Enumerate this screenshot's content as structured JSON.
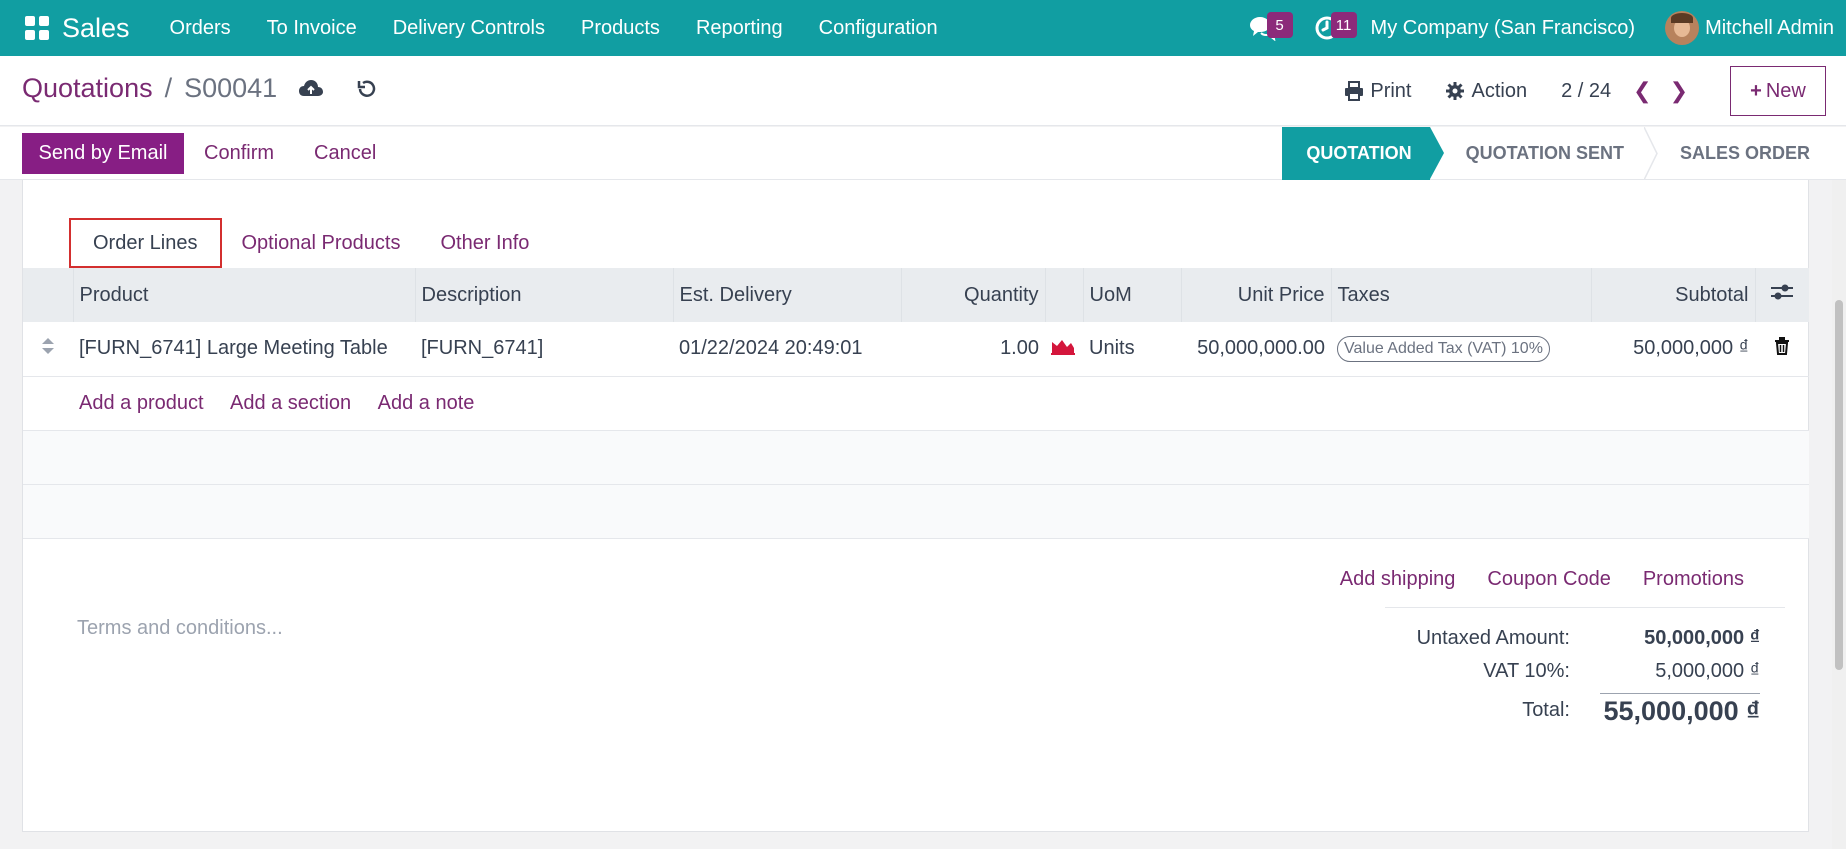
{
  "navbar": {
    "brand": "Sales",
    "menu": [
      "Orders",
      "To Invoice",
      "Delivery Controls",
      "Products",
      "Reporting",
      "Configuration"
    ],
    "messages_count": "5",
    "activities_count": "11",
    "company": "My Company (San Francisco)",
    "user": "Mitchell Admin"
  },
  "breadcrumb": {
    "parent": "Quotations",
    "separator": "/",
    "current": "S00041"
  },
  "control": {
    "print_label": "Print",
    "action_label": "Action",
    "pager": "2 / 24",
    "new_label": "New"
  },
  "statusbar": {
    "send_email_label": "Send by Email",
    "confirm_label": "Confirm",
    "cancel_label": "Cancel",
    "stages": [
      "QUOTATION",
      "QUOTATION SENT",
      "SALES ORDER"
    ],
    "active_stage": "QUOTATION"
  },
  "tabs": [
    "Order Lines",
    "Optional Products",
    "Other Info"
  ],
  "table": {
    "headers": {
      "product": "Product",
      "description": "Description",
      "delivery": "Est. Delivery",
      "quantity": "Quantity",
      "uom": "UoM",
      "unit_price": "Unit Price",
      "taxes": "Taxes",
      "subtotal": "Subtotal"
    },
    "rows": [
      {
        "product": "[FURN_6741] Large Meeting Table",
        "description": "[FURN_6741]",
        "delivery": "01/22/2024 20:49:01",
        "quantity": "1.00",
        "uom": "Units",
        "unit_price": "50,000,000.00",
        "tax": "Value Added Tax (VAT) 10%",
        "subtotal": "50,000,000 ₫"
      }
    ],
    "add_product": "Add a product",
    "add_section": "Add a section",
    "add_note": "Add a note"
  },
  "footer": {
    "add_shipping": "Add shipping",
    "coupon_code": "Coupon Code",
    "promotions": "Promotions",
    "terms_placeholder": "Terms and conditions...",
    "untaxed_label": "Untaxed Amount:",
    "untaxed_value": "50,000,000 ₫",
    "vat_label": "VAT 10%:",
    "vat_value": "5,000,000 ₫",
    "total_label": "Total:",
    "total_value": "55,000,000 ₫"
  },
  "colors": {
    "brand_teal": "#119ea2",
    "primary_purple": "#871e84",
    "link_purple": "#7a2a72",
    "highlight_red": "#d32f2f"
  }
}
